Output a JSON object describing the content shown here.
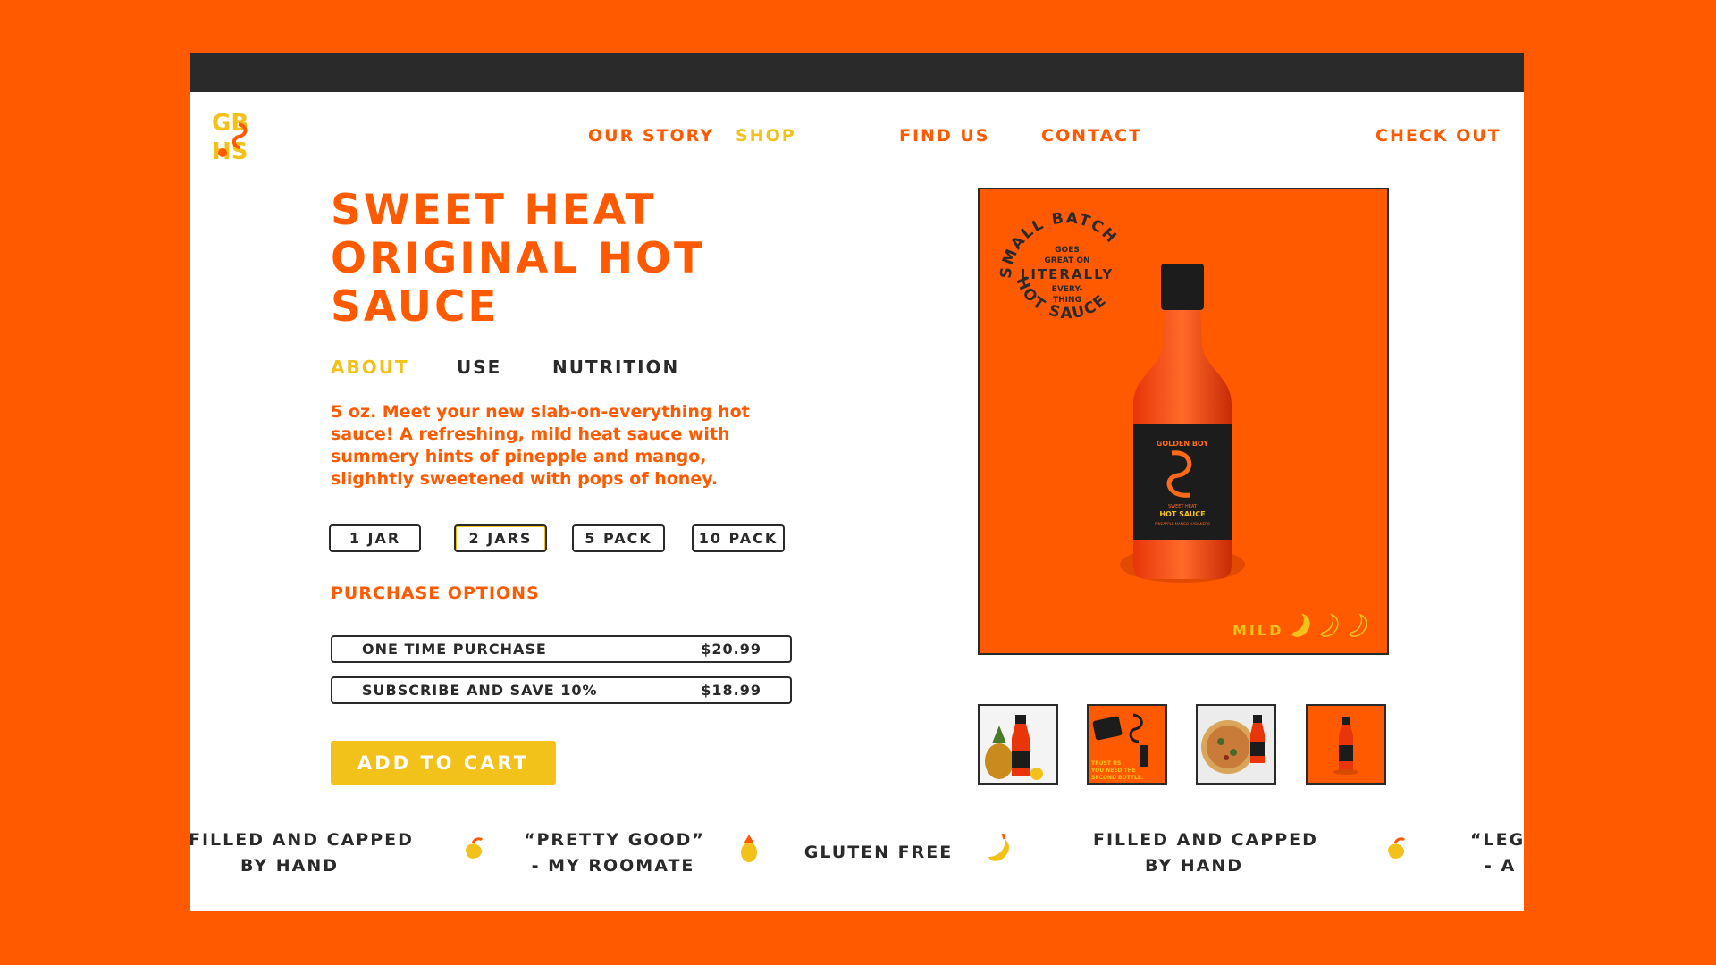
{
  "colors": {
    "brand_orange": "#ff5a00",
    "accent_yellow": "#f3c21a",
    "ink": "#2a2a2a"
  },
  "logo": {
    "text": "GB HS"
  },
  "nav": {
    "our_story": "OUR STORY",
    "shop": "SHOP",
    "find_us": "FIND US",
    "contact": "CONTACT",
    "checkout": "CHECK OUT"
  },
  "product": {
    "title_lines": [
      "SWEET HEAT",
      "ORIGINAL HOT",
      "SAUCE"
    ],
    "tabs": {
      "about": "ABOUT",
      "use": "USE",
      "nutrition": "NUTRITION"
    },
    "description": "5 oz. Meet your new slab-on-everything hot sauce! A refreshing, mild heat sauce with summery hints of pinepple and mango, slighhtly sweetened with pops of honey.",
    "quantities": [
      "1 JAR",
      "2 JARS",
      "5 PACK",
      "10 PACK"
    ],
    "selected_quantity": "2 JARS",
    "purchase_options_label": "PURCHASE OPTIONS",
    "options": [
      {
        "label": "ONE TIME PURCHASE",
        "price": "$20.99"
      },
      {
        "label": "SUBSCRIBE AND SAVE 10%",
        "price": "$18.99"
      }
    ],
    "add_to_cart": "ADD TO CART"
  },
  "hero": {
    "stamp_outer_top": "SMALL BATCH",
    "stamp_outer_bottom": "HOT SAUCE",
    "stamp_inner": [
      "GOES",
      "GREAT ON",
      "LITERALLY",
      "EVERY-",
      "THING"
    ],
    "bottle_label_brand": "GOLDEN BOY",
    "bottle_label_line1": "SWEET HEAT",
    "bottle_label_line2": "HOT SAUCE",
    "bottle_label_line3": "PINEAPPLE MANGO HABANERO",
    "heat_label": "MILD",
    "heat_level": 1,
    "heat_max": 3
  },
  "thumbnails": [
    {
      "icon": "pineapple-bottle-thumb"
    },
    {
      "icon": "trust-us-thumb",
      "caption": "TRUST US, YOU NEED THE SECOND BOTTLE."
    },
    {
      "icon": "pizza-bottle-thumb"
    },
    {
      "icon": "bottle-thumb"
    }
  ],
  "ticker": {
    "item1_line1": "FILLED AND CAPPED",
    "item1_line2": "BY HAND",
    "item2_line1": "“PRETTY GOOD”",
    "item2_line2": "- MY ROOMATE",
    "item3": "GLUTEN FREE",
    "item4_line1": "FILLED AND CAPPED",
    "item4_line2": "BY HAND",
    "item5_line1": "“LEGI",
    "item5_line2": "- A T"
  }
}
